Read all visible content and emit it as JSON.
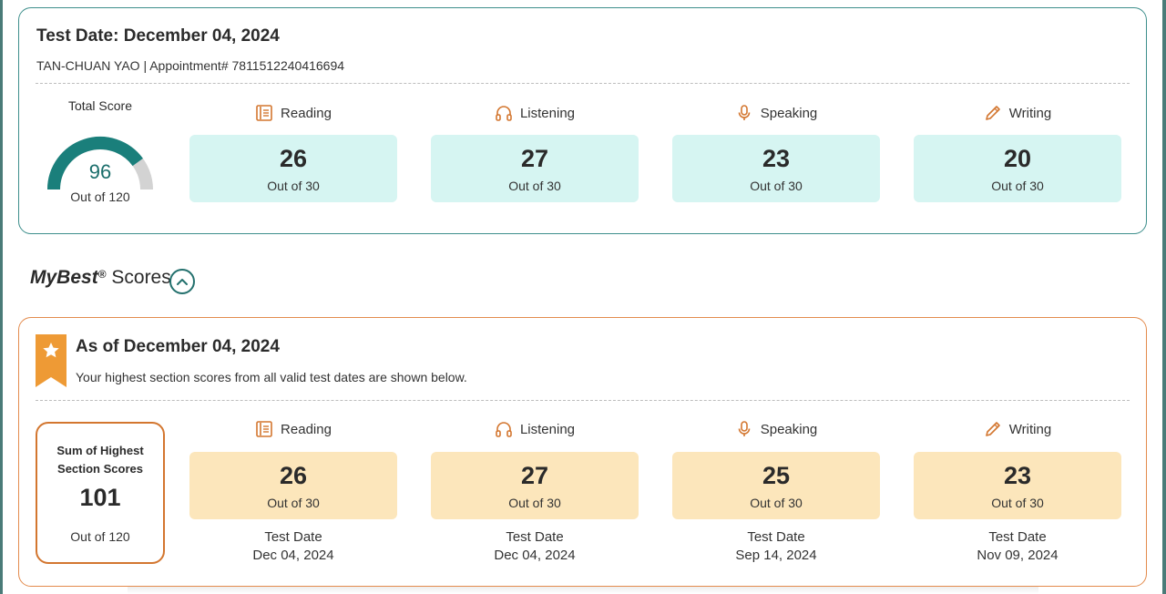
{
  "latest": {
    "title": "Test Date: December 04, 2024",
    "candidate": "TAN-CHUAN YAO  | Appointment# 7811512240416694",
    "total_label": "Total Score",
    "total_value": "96",
    "total_out_of": "Out of 120",
    "total_fraction": 0.8,
    "sections": [
      {
        "name": "Reading",
        "icon": "book-icon",
        "score": "26",
        "out_of": "Out of 30"
      },
      {
        "name": "Listening",
        "icon": "headphones-icon",
        "score": "27",
        "out_of": "Out of 30"
      },
      {
        "name": "Speaking",
        "icon": "microphone-icon",
        "score": "23",
        "out_of": "Out of 30"
      },
      {
        "name": "Writing",
        "icon": "pencil-icon",
        "score": "20",
        "out_of": "Out of 30"
      }
    ]
  },
  "mybest": {
    "heading_italic": "MyBest",
    "heading_reg": "®",
    "heading_rest": " Scores",
    "as_of": "As of December 04, 2024",
    "description": "Your highest section scores from all valid test dates are shown below.",
    "sum_label": "Sum of Highest Section Scores",
    "sum_value": "101",
    "sum_out_of": "Out of 120",
    "test_date_label": "Test Date",
    "sections": [
      {
        "name": "Reading",
        "icon": "book-icon",
        "score": "26",
        "out_of": "Out of 30",
        "date": "Dec 04, 2024"
      },
      {
        "name": "Listening",
        "icon": "headphones-icon",
        "score": "27",
        "out_of": "Out of 30",
        "date": "Dec 04, 2024"
      },
      {
        "name": "Speaking",
        "icon": "microphone-icon",
        "score": "25",
        "out_of": "Out of 30",
        "date": "Sep 14, 2024"
      },
      {
        "name": "Writing",
        "icon": "pencil-icon",
        "score": "23",
        "out_of": "Out of 30",
        "date": "Nov 09, 2024"
      }
    ]
  },
  "colors": {
    "teal_accent": "#1a6e6b",
    "teal_box": "#d6f5f2",
    "gold_box": "#fce6bb",
    "orange_border": "#e38b4d",
    "ribbon": "#ee9a35"
  }
}
